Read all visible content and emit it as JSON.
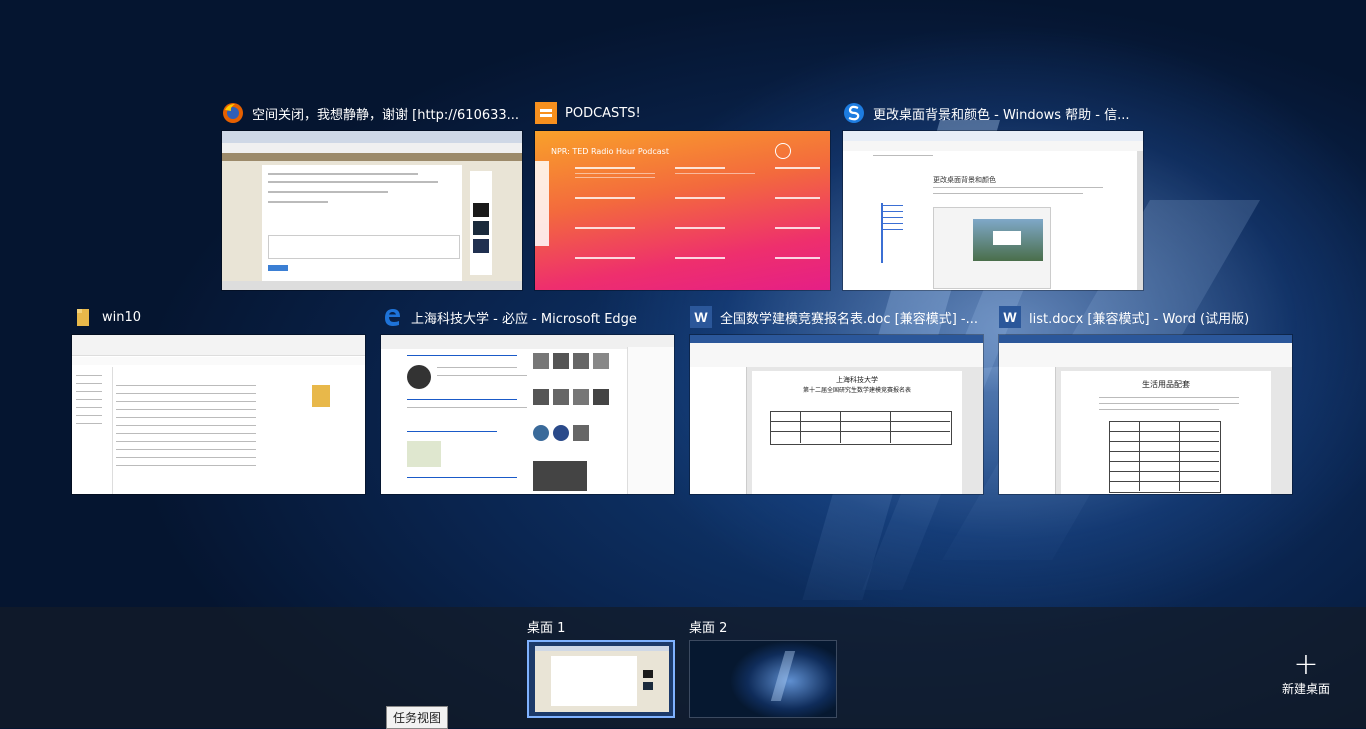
{
  "windows": [
    {
      "title": "空间关闭，我想静静，谢谢 [http://610633...",
      "icon": "firefox-icon"
    },
    {
      "title": "PODCASTS!",
      "icon": "podcasts-icon"
    },
    {
      "title": "更改桌面背景和颜色 - Windows 帮助 - 信...",
      "icon": "sogou-browser-icon"
    },
    {
      "title": "win10",
      "icon": "folder-icon"
    },
    {
      "title": "上海科技大学 - 必应 - Microsoft Edge",
      "icon": "edge-icon"
    },
    {
      "title": "全国数学建模竞赛报名表.doc [兼容模式] -...",
      "icon": "word-icon"
    },
    {
      "title": "list.docx [兼容模式] - Word (试用版)",
      "icon": "word-icon"
    }
  ],
  "podcast": {
    "header": "NPR: TED Radio Hour Podcast"
  },
  "help_page": {
    "heading": "更改桌面背景和颜色"
  },
  "doc1": {
    "line1": "上海科技大学",
    "line2": "第十二届全国研究生数学建模竞赛报名表"
  },
  "doc2": {
    "heading": "生活用品配套"
  },
  "desktops": [
    {
      "label": "桌面 1",
      "active": true
    },
    {
      "label": "桌面 2",
      "active": false
    }
  ],
  "tooltip": "任务视图",
  "new_desktop": {
    "label": "新建桌面",
    "icon": "plus-icon"
  },
  "colors": {
    "accent": "#7fb2ff",
    "podcast_orange": "#f7901e",
    "word_blue": "#2b579a",
    "edge_blue": "#1e73d8"
  }
}
